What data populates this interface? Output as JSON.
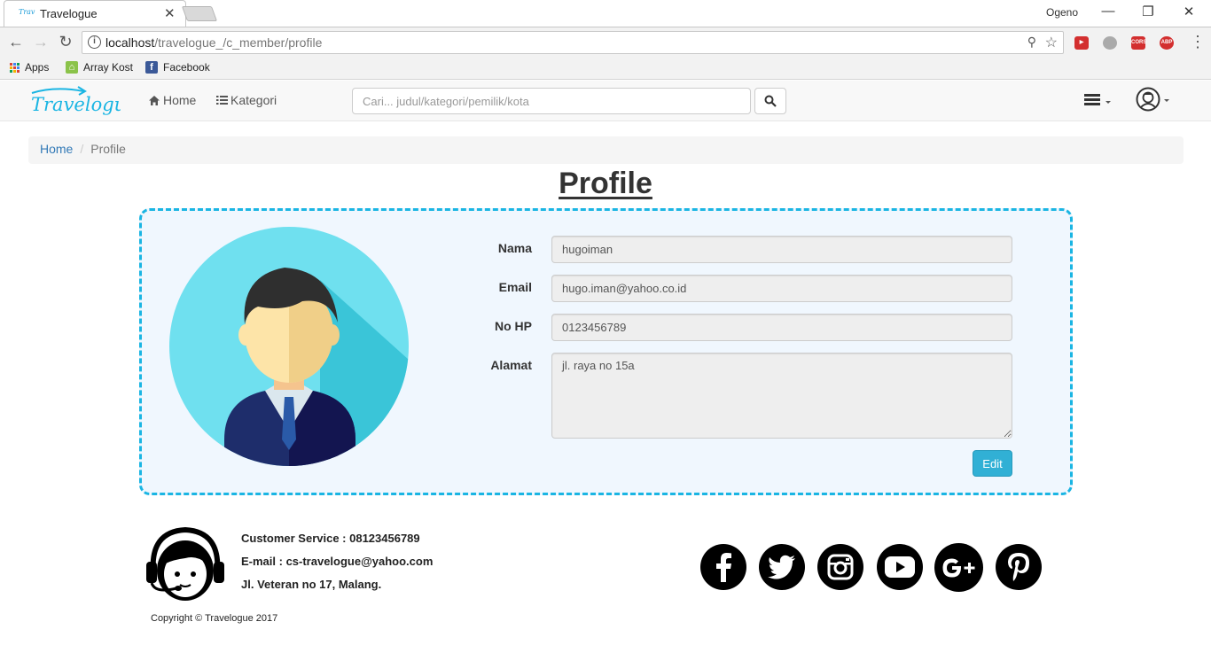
{
  "browser": {
    "tab_title": "Travelogue",
    "favicon_text": "Trav",
    "user_name": "Ogeno",
    "url_host": "localhost",
    "url_path": "/travelogue_/c_member/profile",
    "extensions": [
      {
        "name": "pocket-ext",
        "text": "",
        "color": "#d32f2f"
      },
      {
        "name": "stack-ext",
        "text": "",
        "color": "#9e9e9e"
      },
      {
        "name": "cors-ext",
        "text": "CORS",
        "color": "#d32f2f"
      },
      {
        "name": "abp-ext",
        "text": "ABP",
        "color": "#d32f2f"
      }
    ],
    "bookmarks": [
      {
        "label": "Apps",
        "icon": "apps-grid-icon"
      },
      {
        "label": "Array Kost",
        "icon": "array-kost-icon"
      },
      {
        "label": "Facebook",
        "icon": "facebook-icon"
      }
    ]
  },
  "navbar": {
    "logo_text": "Travelogue",
    "home_label": "Home",
    "kategori_label": "Kategori",
    "search_placeholder": "Cari... judul/kategori/pemilik/kota"
  },
  "breadcrumb": {
    "home": "Home",
    "current": "Profile"
  },
  "profile": {
    "title": "Profile",
    "fields": {
      "nama_label": "Nama",
      "nama_value": "hugoiman",
      "email_label": "Email",
      "email_value": "hugo.iman@yahoo.co.id",
      "hp_label": "No HP",
      "hp_value": "0123456789",
      "alamat_label": "Alamat",
      "alamat_value": "jl. raya no 15a"
    },
    "edit_label": "Edit"
  },
  "footer": {
    "customer_service": "Customer Service : 08123456789",
    "email": "E-mail : cs-travelogue@yahoo.com",
    "address": "Jl. Veteran no 17, Malang.",
    "copyright": "Copyright © Travelogue 2017",
    "social": [
      "facebook-icon",
      "twitter-icon",
      "instagram-icon",
      "youtube-icon",
      "google-plus-icon",
      "pinterest-icon"
    ]
  },
  "colors": {
    "accent": "#1ab5e3",
    "link": "#337ab7",
    "edit_button": "#31b0d5",
    "panel_bg": "#f0f7fe"
  }
}
